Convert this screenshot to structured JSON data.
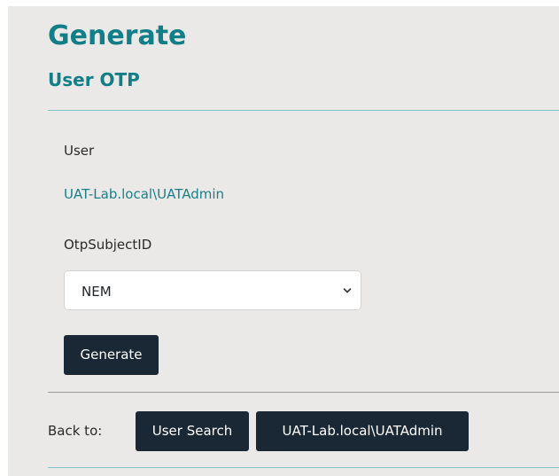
{
  "header": {
    "title": "Generate",
    "subtitle": "User OTP"
  },
  "form": {
    "user_label": "User",
    "user_value": "UAT-Lab.local\\UATAdmin",
    "otp_subject_label": "OtpSubjectID",
    "otp_subject_selected": "NEM",
    "generate_button": "Generate"
  },
  "footer": {
    "back_to_label": "Back to:",
    "user_search_button": "User Search",
    "user_button": "UAT-Lab.local\\UATAdmin"
  },
  "colors": {
    "accent": "#127e87",
    "button_bg": "#1a2734",
    "panel_bg": "#ebe9e7"
  },
  "icons": {
    "select_chevron": "chevron-down-icon"
  }
}
